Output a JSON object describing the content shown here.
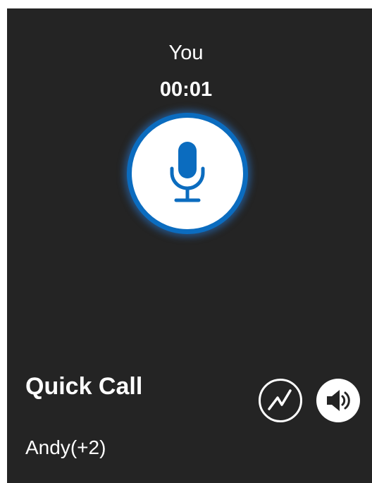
{
  "call": {
    "caller_name": "You",
    "timer": "00:01",
    "title": "Quick Call",
    "participants": "Andy(+2)"
  },
  "icons": {
    "mic": "microphone-icon",
    "stats": "activity-chart-icon",
    "speaker": "speaker-icon"
  },
  "colors": {
    "background": "#242424",
    "accent": "#0b6cbf",
    "text": "#ffffff"
  }
}
